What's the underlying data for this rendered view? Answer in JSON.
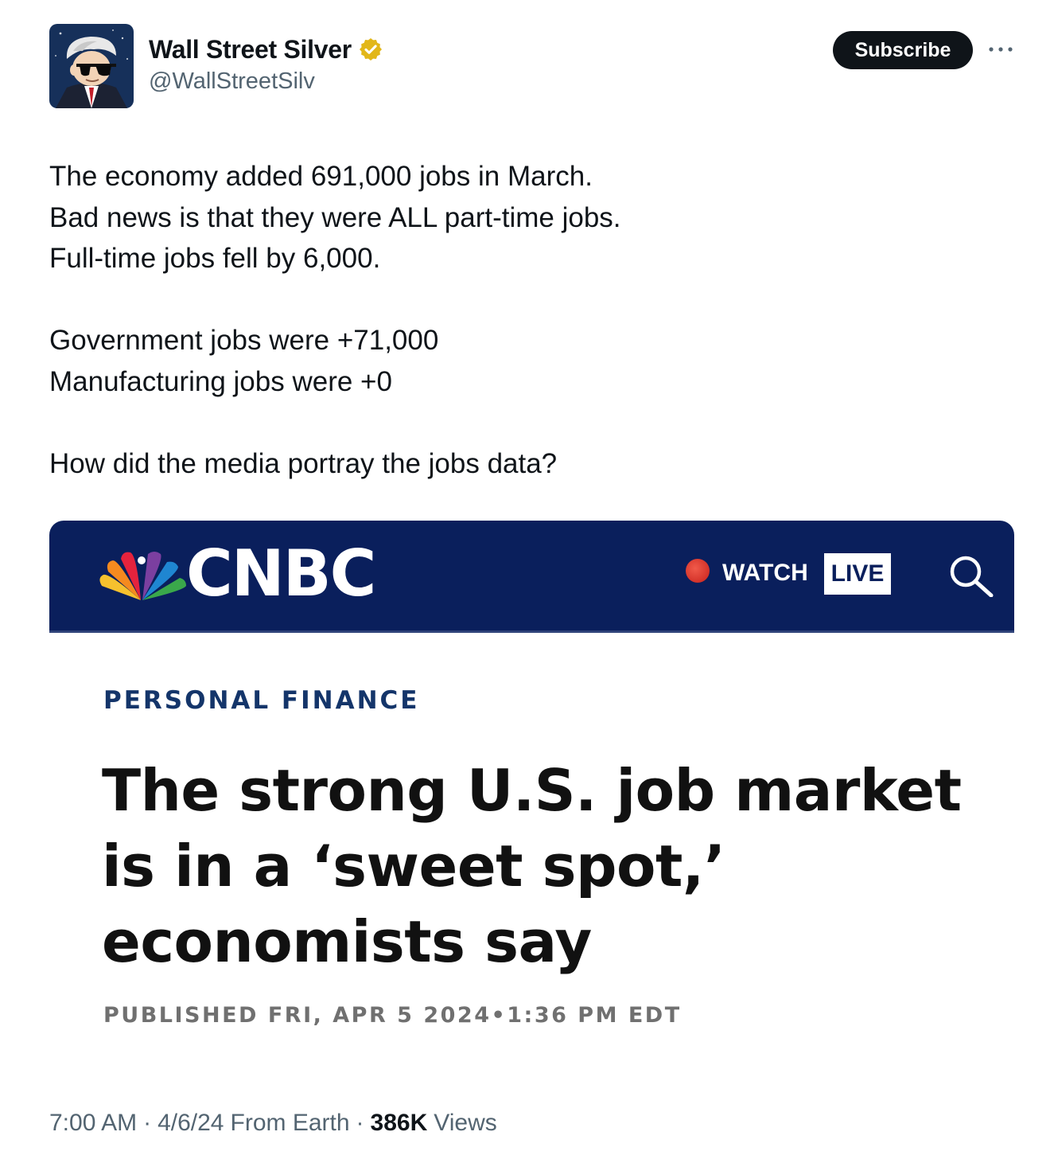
{
  "author": {
    "name": "Wall Street Silver",
    "handle": "@WallStreetSilv",
    "verified": true,
    "verified_badge_color": "#e2b719"
  },
  "subscribe_label": "Subscribe",
  "tweet_text_lines": [
    "The economy added 691,000 jobs in March.",
    "Bad news is that they were ALL part-time jobs.",
    "Full-time jobs fell by 6,000.",
    "",
    "Government jobs were +71,000",
    "Manufacturing jobs were +0",
    "",
    "How did the media portray the jobs data?"
  ],
  "media": {
    "brand_wordmark": "CNBC",
    "watch_label": "WATCH",
    "live_label": "LIVE",
    "header_color": "#0a1f5c",
    "section": "PERSONAL FINANCE",
    "headline_lines": [
      "The strong U.S. job market",
      "is in a ‘sweet spot,’",
      "economists say"
    ],
    "published": "PUBLISHED FRI, APR 5 2024•1:36 PM EDT"
  },
  "meta": {
    "time": "7:00 AM",
    "date": "4/6/24",
    "location": "From Earth",
    "views_count": "386K",
    "views_label": "Views"
  }
}
